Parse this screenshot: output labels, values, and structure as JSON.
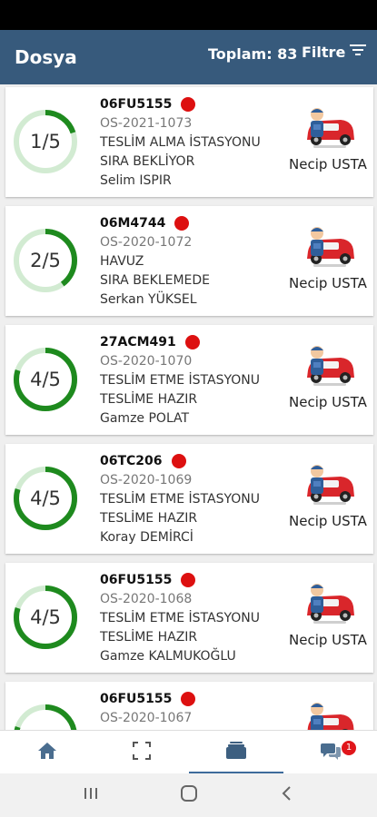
{
  "header": {
    "title": "Dosya",
    "total": "Toplam: 83",
    "filter_label": "Filtre"
  },
  "colors": {
    "header_bg": "#375a7c",
    "progress_fg": "#1e8a1e",
    "progress_bg": "#d2ebd2",
    "status_dot": "#dd1010"
  },
  "cards": [
    {
      "plate": "06FU5155",
      "file_no": "OS-2021-1073",
      "station": "TESLİM ALMA İSTASYONU",
      "status": "SIRA BEKLİYOR",
      "customer": "Selim ISPIR",
      "mechanic": "Necip USTA",
      "progress_label": "1/5",
      "progress": 0.2
    },
    {
      "plate": "06M4744",
      "file_no": "OS-2020-1072",
      "station": "HAVUZ",
      "status": "SIRA BEKLEMEDE",
      "customer": "Serkan YÜKSEL",
      "mechanic": "Necip USTA",
      "progress_label": "2/5",
      "progress": 0.4
    },
    {
      "plate": "27ACM491",
      "file_no": "OS-2020-1070",
      "station": "TESLİM ETME İSTASYONU",
      "status": "TESLİME HAZIR",
      "customer": "Gamze POLAT",
      "mechanic": "Necip USTA",
      "progress_label": "4/5",
      "progress": 0.8
    },
    {
      "plate": "06TC206",
      "file_no": "OS-2020-1069",
      "station": "TESLİM ETME İSTASYONU",
      "status": "TESLİME HAZIR",
      "customer": "Koray DEMİRCİ",
      "mechanic": "Necip USTA",
      "progress_label": "4/5",
      "progress": 0.8
    },
    {
      "plate": "06FU5155",
      "file_no": "OS-2020-1068",
      "station": "TESLİM ETME İSTASYONU",
      "status": "TESLİME HAZIR",
      "customer": "Gamze KALMUKOĞLU",
      "mechanic": "Necip USTA",
      "progress_label": "4/5",
      "progress": 0.8
    },
    {
      "plate": "06FU5155",
      "file_no": "OS-2020-1067",
      "station": "",
      "status": "",
      "customer": "",
      "mechanic": "",
      "progress_label": "",
      "progress": 0.8
    }
  ],
  "bottom_nav": {
    "items": [
      {
        "icon": "home-icon"
      },
      {
        "icon": "scan-icon"
      },
      {
        "icon": "folder-icon",
        "active": true
      },
      {
        "icon": "chat-icon"
      }
    ],
    "chat_badge": "1"
  }
}
